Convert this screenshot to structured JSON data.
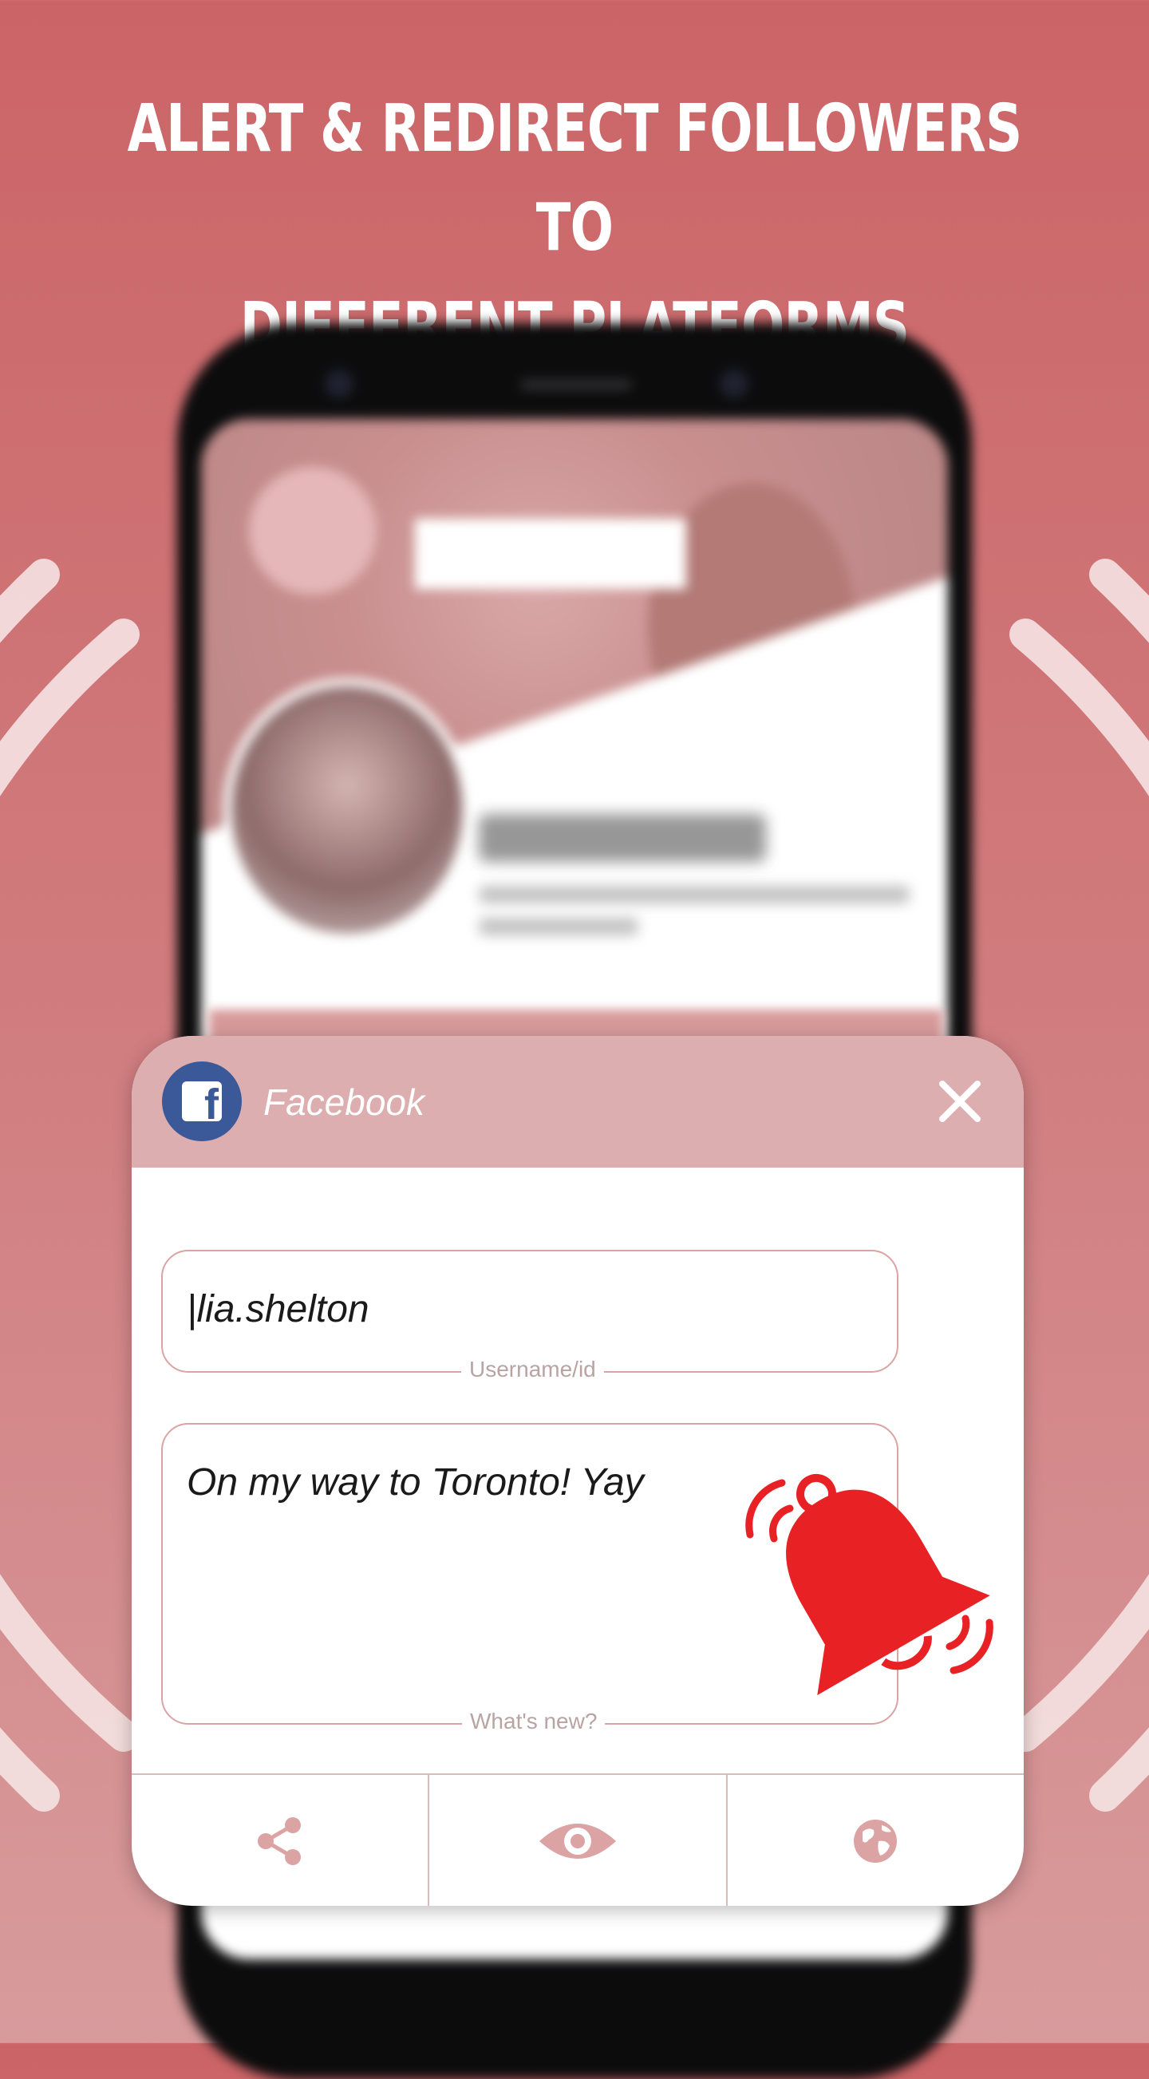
{
  "headline": {
    "line1": "ALERT & REDIRECT FOLLOWERS TO",
    "line2": "DIFFERENT PLATFORMS"
  },
  "popup": {
    "platform": "Facebook",
    "platform_icon": "facebook-icon",
    "username_value": "|lia.shelton",
    "username_label": "Username/id",
    "status_value": "On my way to Toronto! Yay",
    "status_label": "What's new?",
    "actions": [
      "share-icon",
      "eye-icon",
      "globe-icon"
    ]
  },
  "colors": {
    "background_top": "#cb6467",
    "header": "#dcaeaf",
    "facebook_blue": "#3b5998",
    "bell_red": "#e82124",
    "field_border": "#dba3a4"
  }
}
